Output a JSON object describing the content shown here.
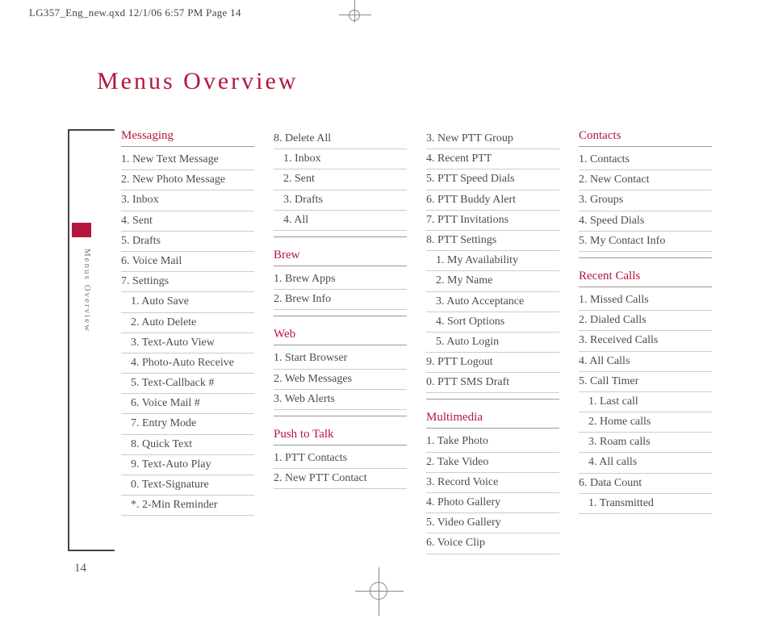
{
  "header": "LG357_Eng_new.qxd  12/1/06  6:57 PM  Page 14",
  "title": "Menus Overview",
  "side_label": "Menus Overview",
  "page_number": "14",
  "cols": [
    [
      {
        "type": "title",
        "text": "Messaging"
      },
      {
        "type": "item",
        "text": "1. New Text Message"
      },
      {
        "type": "item",
        "text": "2. New Photo Message"
      },
      {
        "type": "item",
        "text": "3. Inbox"
      },
      {
        "type": "item",
        "text": "4. Sent"
      },
      {
        "type": "item",
        "text": "5. Drafts"
      },
      {
        "type": "item",
        "text": "6. Voice Mail"
      },
      {
        "type": "item",
        "text": "7. Settings"
      },
      {
        "type": "sub",
        "text": "1. Auto Save"
      },
      {
        "type": "sub",
        "text": "2. Auto Delete"
      },
      {
        "type": "sub",
        "text": "3. Text-Auto View"
      },
      {
        "type": "sub",
        "text": "4. Photo-Auto Receive"
      },
      {
        "type": "sub",
        "text": "5. Text-Callback #"
      },
      {
        "type": "sub",
        "text": "6. Voice Mail #"
      },
      {
        "type": "sub",
        "text": "7. Entry Mode"
      },
      {
        "type": "sub",
        "text": "8. Quick Text"
      },
      {
        "type": "sub",
        "text": "9. Text-Auto Play"
      },
      {
        "type": "sub",
        "text": "0. Text-Signature"
      },
      {
        "type": "sub",
        "text": "*. 2-Min Reminder"
      }
    ],
    [
      {
        "type": "item",
        "text": "8. Delete All"
      },
      {
        "type": "sub",
        "text": "1. Inbox"
      },
      {
        "type": "sub",
        "text": "2. Sent"
      },
      {
        "type": "sub",
        "text": "3. Drafts"
      },
      {
        "type": "sub",
        "text": "4. All"
      },
      {
        "type": "spacer"
      },
      {
        "type": "title",
        "text": "Brew"
      },
      {
        "type": "item",
        "text": "1. Brew Apps"
      },
      {
        "type": "item",
        "text": "2. Brew Info"
      },
      {
        "type": "spacer"
      },
      {
        "type": "title",
        "text": "Web"
      },
      {
        "type": "item",
        "text": "1. Start Browser"
      },
      {
        "type": "item",
        "text": "2. Web Messages"
      },
      {
        "type": "item",
        "text": "3. Web Alerts"
      },
      {
        "type": "spacer"
      },
      {
        "type": "title",
        "text": "Push to Talk"
      },
      {
        "type": "item",
        "text": "1. PTT Contacts"
      },
      {
        "type": "item",
        "text": "2. New PTT Contact"
      }
    ],
    [
      {
        "type": "item",
        "text": "3. New PTT Group"
      },
      {
        "type": "item",
        "text": "4. Recent PTT"
      },
      {
        "type": "item",
        "text": "5. PTT Speed Dials"
      },
      {
        "type": "item",
        "text": "6. PTT Buddy Alert"
      },
      {
        "type": "item",
        "text": "7.  PTT Invitations"
      },
      {
        "type": "item",
        "text": "8. PTT Settings"
      },
      {
        "type": "sub",
        "text": "1. My Availability"
      },
      {
        "type": "sub",
        "text": "2. My Name"
      },
      {
        "type": "sub",
        "text": "3. Auto Acceptance"
      },
      {
        "type": "sub",
        "text": "4. Sort Options"
      },
      {
        "type": "sub",
        "text": "5. Auto Login"
      },
      {
        "type": "item",
        "text": "9. PTT Logout"
      },
      {
        "type": "item",
        "text": "0. PTT SMS Draft"
      },
      {
        "type": "spacer"
      },
      {
        "type": "title",
        "text": "Multimedia"
      },
      {
        "type": "item",
        "text": "1. Take Photo"
      },
      {
        "type": "item",
        "text": "2. Take Video"
      },
      {
        "type": "item",
        "text": "3. Record Voice"
      },
      {
        "type": "item",
        "text": "4. Photo Gallery"
      },
      {
        "type": "item",
        "text": "5. Video Gallery"
      },
      {
        "type": "item",
        "text": "6. Voice Clip"
      }
    ],
    [
      {
        "type": "title",
        "text": "Contacts"
      },
      {
        "type": "item",
        "text": "1. Contacts"
      },
      {
        "type": "item",
        "text": "2. New Contact"
      },
      {
        "type": "item",
        "text": "3. Groups"
      },
      {
        "type": "item",
        "text": "4. Speed Dials"
      },
      {
        "type": "item",
        "text": "5. My Contact Info"
      },
      {
        "type": "spacer"
      },
      {
        "type": "title",
        "text": "Recent Calls"
      },
      {
        "type": "item",
        "text": "1. Missed Calls"
      },
      {
        "type": "item",
        "text": "2. Dialed Calls"
      },
      {
        "type": "item",
        "text": "3. Received Calls"
      },
      {
        "type": "item",
        "text": "4. All Calls"
      },
      {
        "type": "item",
        "text": "5. Call Timer"
      },
      {
        "type": "sub",
        "text": "1. Last call"
      },
      {
        "type": "sub",
        "text": "2. Home calls"
      },
      {
        "type": "sub",
        "text": "3. Roam calls"
      },
      {
        "type": "sub",
        "text": "4. All calls"
      },
      {
        "type": "item",
        "text": "6. Data Count"
      },
      {
        "type": "sub",
        "text": "1. Transmitted"
      }
    ]
  ]
}
